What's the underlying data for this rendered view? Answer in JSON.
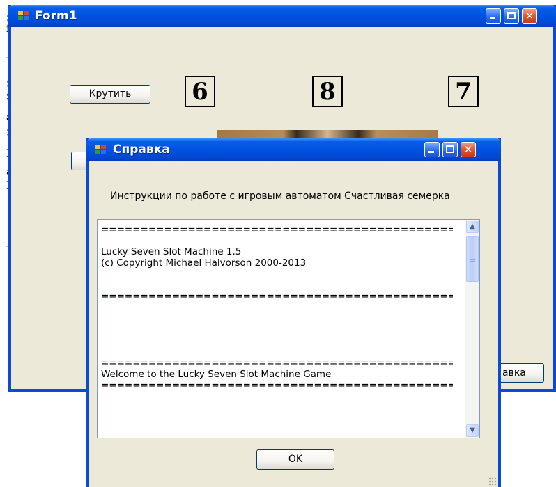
{
  "background_doc": {
    "fragments": [
      {
        "text": "S",
        "link": true
      },
      {
        "text": "i",
        "link": false
      },
      {
        "text": "S",
        "link": true
      },
      {
        "text": "S",
        "link": false
      },
      {
        "text": "a",
        "link": false
      },
      {
        "text": "S",
        "link": true
      },
      {
        "text": "B",
        "link": false
      },
      {
        "text": "a",
        "link": false
      },
      {
        "text": "B",
        "link": false
      }
    ]
  },
  "form1": {
    "title": "Form1",
    "icon": "app-icon",
    "spin_button": "Крутить",
    "reels": [
      "6",
      "8",
      "7"
    ],
    "hidden_button_partial": "авка"
  },
  "help_dialog": {
    "title": "Справка",
    "icon": "app-icon",
    "instruction_label": "Инструкции по работе с игровым автоматом Счастливая семерка",
    "text_lines": [
      "=============================================",
      "",
      "Lucky Seven Slot Machine 1.5",
      "(c) Copyright Michael Halvorson 2000-2013",
      "",
      "",
      "=============================================",
      "",
      "",
      "",
      "",
      "",
      "=============================================",
      "Welcome to the Lucky Seven Slot Machine Game",
      "============================================="
    ],
    "ok_button": "OK"
  },
  "colors": {
    "titlebar_blue": "#0054e3",
    "window_face": "#ece9d8",
    "close_red": "#df5631",
    "link_blue": "#3a55d8"
  }
}
